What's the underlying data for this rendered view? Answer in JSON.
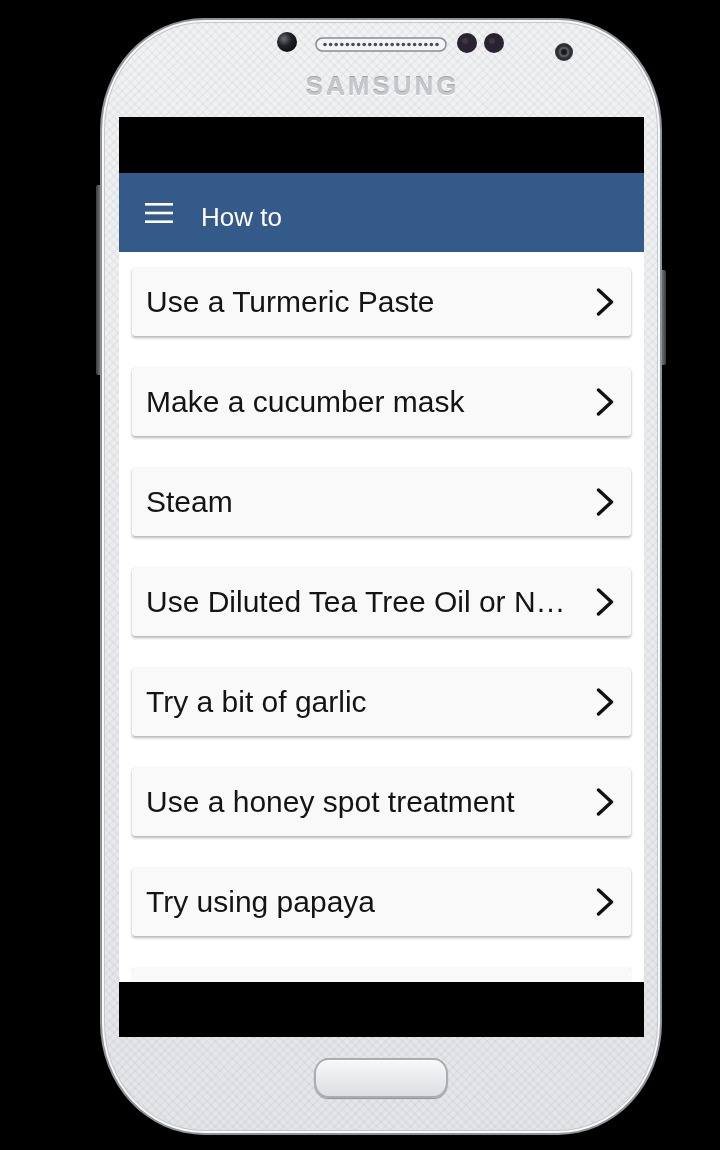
{
  "device": {
    "brand": "SAMSUNG"
  },
  "app_bar": {
    "title": "How to"
  },
  "items": [
    {
      "label": "Use a Turmeric Paste"
    },
    {
      "label": "Make a cucumber mask"
    },
    {
      "label": "Steam"
    },
    {
      "label": "Use Diluted Tea Tree Oil or N…"
    },
    {
      "label": "Try a bit of garlic"
    },
    {
      "label": "Use a honey spot treatment"
    },
    {
      "label": "Try using papaya"
    }
  ]
}
